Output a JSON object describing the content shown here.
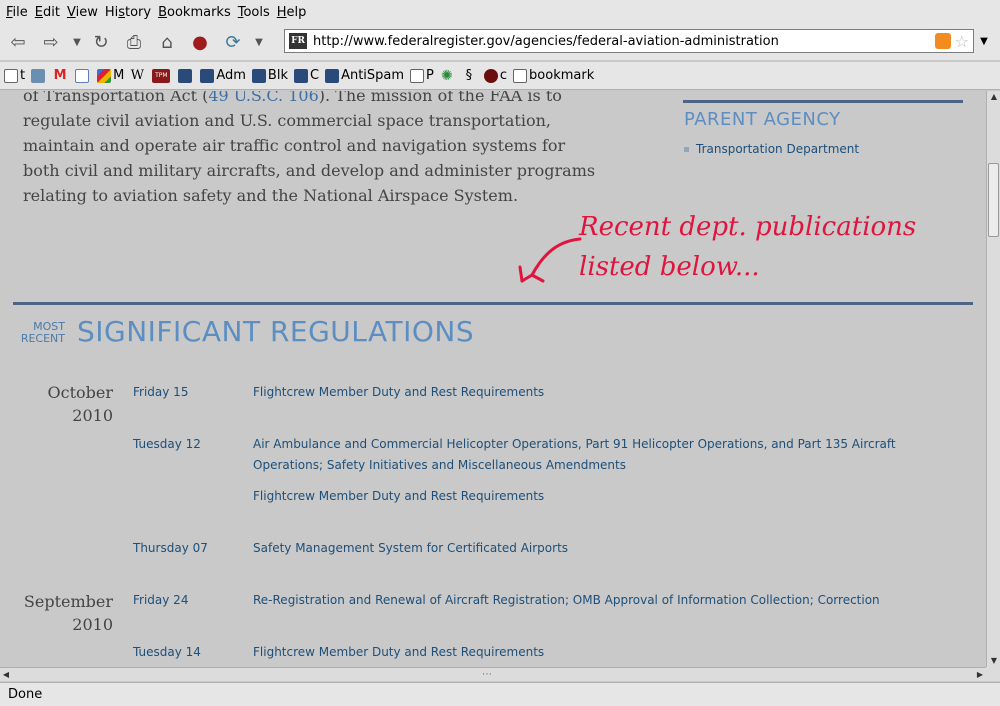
{
  "menu": [
    "File",
    "Edit",
    "View",
    "History",
    "Bookmarks",
    "Tools",
    "Help"
  ],
  "menu_mnemonics": [
    "F",
    "E",
    "V",
    "s",
    "B",
    "T",
    "H"
  ],
  "url": "http://www.federalregister.gov/agencies/federal-aviation-administration",
  "favicon_text": "FR",
  "bookmarks": [
    {
      "label": "t",
      "icon": "page-icon"
    },
    {
      "label": "",
      "icon": "grid-icon"
    },
    {
      "label": "",
      "icon": "gmail-icon"
    },
    {
      "label": "",
      "icon": "calendar-icon"
    },
    {
      "label": "M",
      "icon": "google-icon"
    },
    {
      "label": "",
      "icon": "wikipedia-icon"
    },
    {
      "label": "",
      "icon": "tpm-icon",
      "text": "TPM"
    },
    {
      "label": "",
      "icon": "bookmarklet-icon"
    },
    {
      "label": "Adm",
      "icon": "bookmarklet-icon"
    },
    {
      "label": "Blk",
      "icon": "bookmarklet-icon"
    },
    {
      "label": "C",
      "icon": "bookmarklet-icon"
    },
    {
      "label": "AntiSpam",
      "icon": "bookmarklet-icon"
    },
    {
      "label": "P",
      "icon": "page-icon"
    },
    {
      "label": "",
      "icon": "gear-icon"
    },
    {
      "label": "",
      "icon": "ink-icon"
    },
    {
      "label": "c",
      "icon": "ball-icon"
    },
    {
      "label": "bookmark",
      "icon": "note-icon"
    }
  ],
  "mission": {
    "pre_link": "of Transportation Act (",
    "link": "49 U.S.C. 106",
    "post_link": "). The mission of the FAA is to regulate civil aviation and U.S. commercial space transportation, maintain and operate air traffic control and navigation systems for both civil and military aircrafts, and develop and administer programs relating to aviation safety and the National Airspace System."
  },
  "parent_agency": {
    "title": "PARENT AGENCY",
    "item": "Transportation Department"
  },
  "annotation": {
    "line1": "Recent dept. publications",
    "line2": "listed below..."
  },
  "section": {
    "most": "MOST",
    "recent": "RECENT",
    "title": "SIGNIFICANT REGULATIONS"
  },
  "months": [
    {
      "month": "October",
      "year": "2010"
    },
    {
      "month": "September",
      "year": "2010"
    }
  ],
  "publications": [
    {
      "day": "Friday 15",
      "title": "Flightcrew Member Duty and Rest Requirements"
    },
    {
      "day": "Tuesday 12",
      "title": "Air Ambulance and Commercial Helicopter Operations, Part 91 Helicopter Operations, and Part 135 Aircraft Operations; Safety Initiatives and Miscellaneous Amendments"
    },
    {
      "day": "",
      "title": "Flightcrew Member Duty and Rest Requirements"
    },
    {
      "day": "Thursday 07",
      "title": "Safety Management System for Certificated Airports"
    },
    {
      "day": "Friday 24",
      "title": "Re-Registration and Renewal of Aircraft Registration; OMB Approval of Information Collection; Correction"
    },
    {
      "day": "Tuesday 14",
      "title": "Flightcrew Member Duty and Rest Requirements"
    }
  ],
  "status": "Done",
  "colors": {
    "accent_blue": "#5c8ec2",
    "link_blue": "#1d4f7a",
    "annotation_red": "#e0143d",
    "rule": "#4a6585"
  }
}
